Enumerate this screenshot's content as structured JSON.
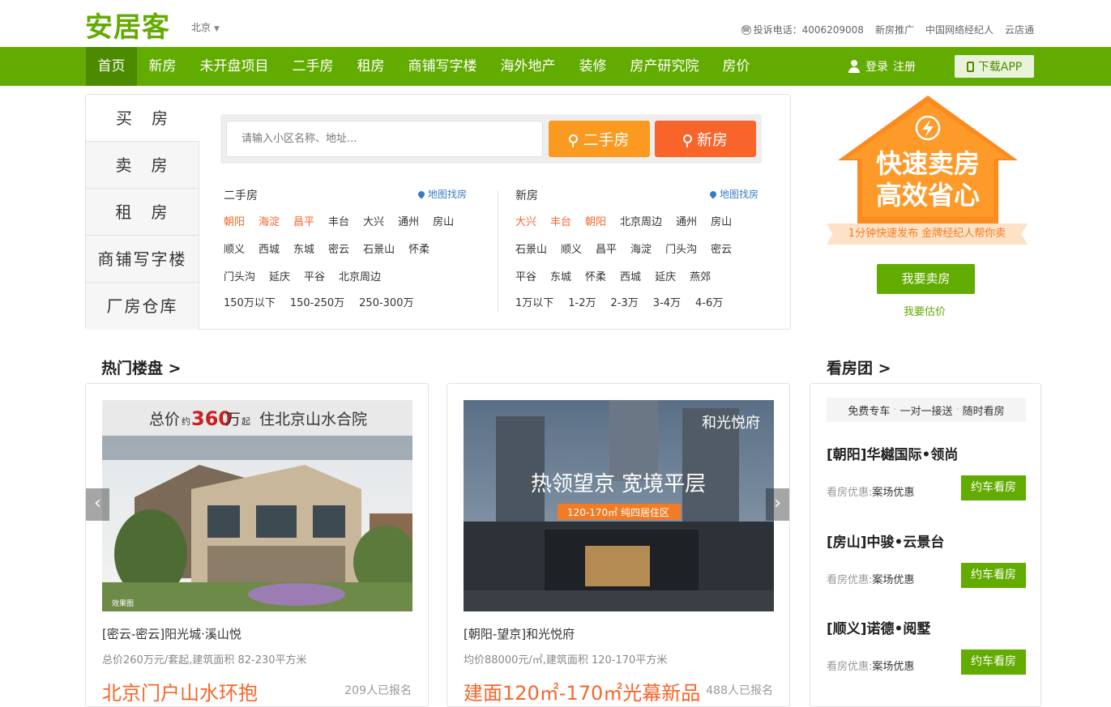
{
  "header": {
    "logo": "安居客",
    "city": "北京",
    "complaint_phone": "投诉电话：4006209008",
    "links": [
      "新房推广",
      "中国网络经纪人",
      "云店通"
    ]
  },
  "nav": {
    "items": [
      "首页",
      "新房",
      "未开盘项目",
      "二手房",
      "租房",
      "商铺写字楼",
      "海外地产",
      "装修",
      "房产研究院",
      "房价"
    ],
    "login": "登录",
    "register": "注册",
    "download": "下载APP"
  },
  "search": {
    "tabs": [
      "买　房",
      "卖　房",
      "租　房",
      "商铺写字楼",
      "厂房仓库"
    ],
    "placeholder": "请输入小区名称、地址...",
    "btn_old": "二手房",
    "btn_new": "新房",
    "old": {
      "title": "二手房",
      "map": "地图找房",
      "districts": [
        {
          "name": "朝阳",
          "hot": true
        },
        {
          "name": "海淀",
          "hot": true
        },
        {
          "name": "昌平",
          "hot": true
        },
        {
          "name": "丰台",
          "hot": false
        },
        {
          "name": "大兴",
          "hot": false
        },
        {
          "name": "通州",
          "hot": false
        },
        {
          "name": "房山",
          "hot": false
        },
        {
          "name": "顺义",
          "hot": false
        },
        {
          "name": "西城",
          "hot": false
        },
        {
          "name": "东城",
          "hot": false
        },
        {
          "name": "密云",
          "hot": false
        },
        {
          "name": "石景山",
          "hot": false
        },
        {
          "name": "怀柔",
          "hot": false
        },
        {
          "name": "门头沟",
          "hot": false
        },
        {
          "name": "延庆",
          "hot": false
        },
        {
          "name": "平谷",
          "hot": false
        },
        {
          "name": "北京周边",
          "hot": false
        }
      ],
      "prices": [
        "150万以下",
        "150-250万",
        "250-300万"
      ]
    },
    "new": {
      "title": "新房",
      "map": "地图找房",
      "districts": [
        {
          "name": "大兴",
          "hot": true
        },
        {
          "name": "丰台",
          "hot": true
        },
        {
          "name": "朝阳",
          "hot": true
        },
        {
          "name": "北京周边",
          "hot": false
        },
        {
          "name": "通州",
          "hot": false
        },
        {
          "name": "房山",
          "hot": false
        },
        {
          "name": "石景山",
          "hot": false
        },
        {
          "name": "顺义",
          "hot": false
        },
        {
          "name": "昌平",
          "hot": false
        },
        {
          "name": "海淀",
          "hot": false
        },
        {
          "name": "门头沟",
          "hot": false
        },
        {
          "name": "密云",
          "hot": false
        },
        {
          "name": "平谷",
          "hot": false
        },
        {
          "name": "东城",
          "hot": false
        },
        {
          "name": "怀柔",
          "hot": false
        },
        {
          "name": "西城",
          "hot": false
        },
        {
          "name": "延庆",
          "hot": false
        },
        {
          "name": "燕郊",
          "hot": false
        }
      ],
      "prices": [
        "1万以下",
        "1-2万",
        "2-3万",
        "3-4万",
        "4-6万"
      ]
    }
  },
  "promo": {
    "line1": "快速卖房",
    "line2": "高效省心",
    "ribbon": "1分钟快速发布 金牌经纪人帮你卖",
    "sell_btn": "我要卖房",
    "estimate": "我要估价"
  },
  "hot": {
    "title": "热门楼盘 >",
    "cards": [
      {
        "img_headline": "总价",
        "img_small": "约",
        "img_price": "360",
        "img_unit": "万",
        "img_after": "起",
        "img_tail": "住北京山水合院",
        "img_note": "效果图",
        "name": "[密云-密云]阳光城·溪山悦",
        "info": "总价260万元/套起,建筑面积 82-230平方米",
        "slogan": "北京门户山水环抱",
        "count": "209人已报名"
      },
      {
        "img_headline": "热领望京 宽境平层",
        "img_sub": "120-170㎡ 纯四居住区",
        "img_brand": "和光悦府",
        "name": "[朝阳-望京]和光悦府",
        "info": "均价88000元/㎡,建筑面积 120-170平方米",
        "slogan": "建面120㎡-170㎡光幕新品",
        "count": "488人已报名"
      }
    ]
  },
  "tour": {
    "title": "看房团 >",
    "tags": [
      "免费专车",
      "一对一接送",
      "随时看房"
    ],
    "items": [
      {
        "name": "[朝阳]华樾国际•领尚",
        "label": "看房优惠:",
        "value": "案场优惠",
        "btn": "约车看房"
      },
      {
        "name": "[房山]中骏•云景台",
        "label": "看房优惠:",
        "value": "案场优惠",
        "btn": "约车看房"
      },
      {
        "name": "[顺义]诺德•阅墅",
        "label": "看房优惠:",
        "value": "案场优惠",
        "btn": "约车看房"
      }
    ]
  },
  "colors": {
    "brand": "#62ab00",
    "orange": "#fb9a20",
    "red_orange": "#f9642a",
    "link_blue": "#3c7ac5"
  }
}
